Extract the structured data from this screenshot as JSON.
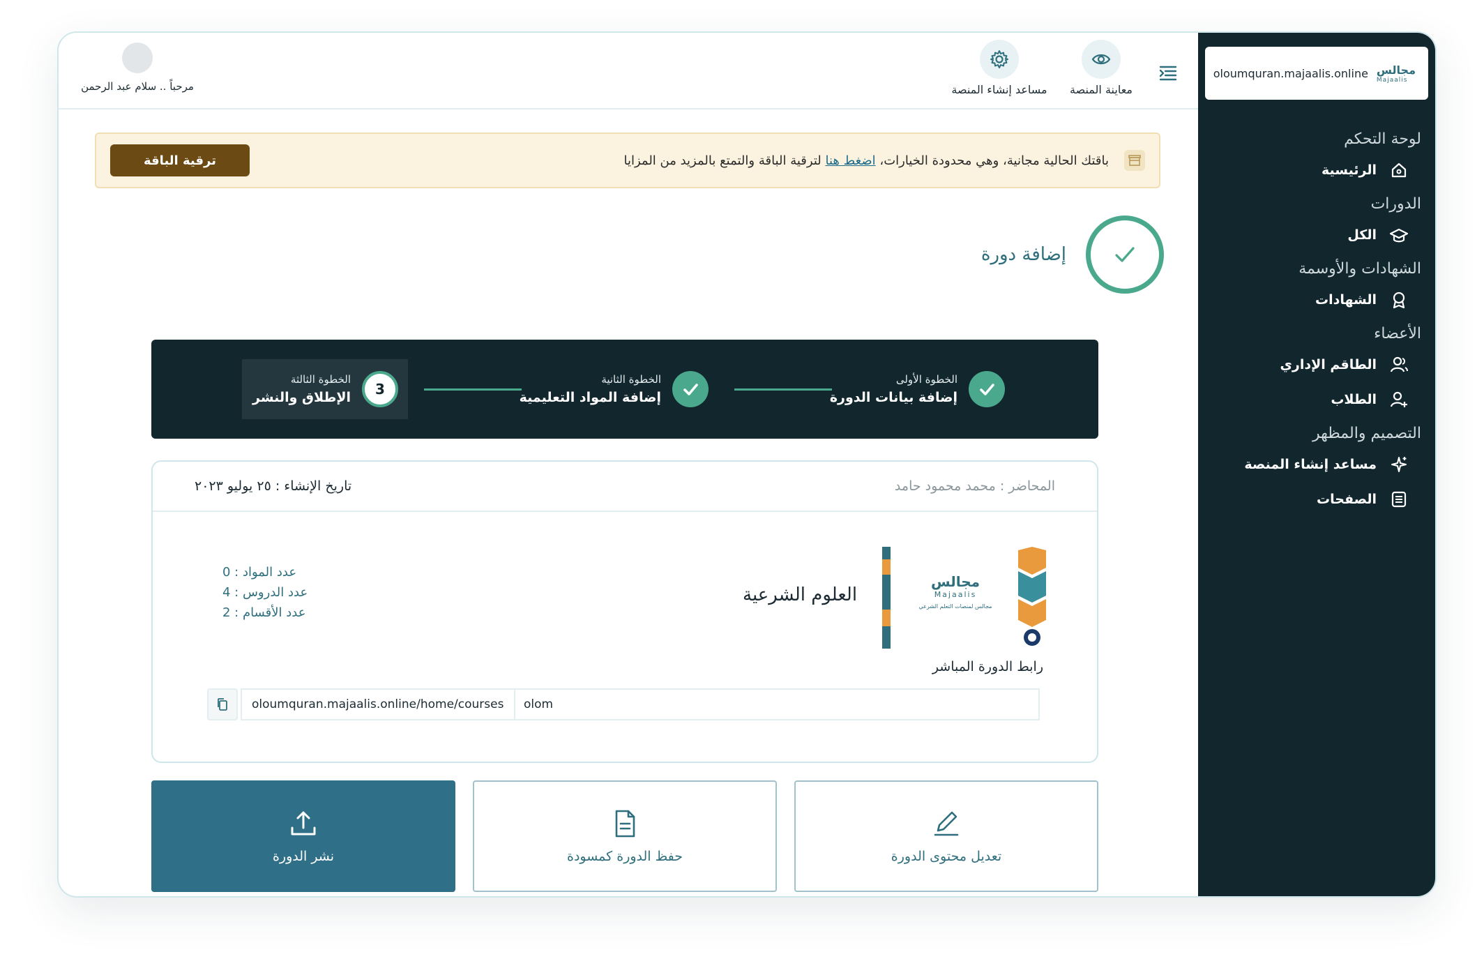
{
  "sidebar": {
    "domain": "oloumquran.majaalis.online",
    "logo_ar": "مجالس",
    "logo_en": "Majaalis",
    "sections": {
      "dashboard": "لوحة التحكم",
      "courses": "الدورات",
      "certificates": "الشهادات والأوسمة",
      "members": "الأعضاء",
      "design": "التصميم والمظهر"
    },
    "items": {
      "home": "الرئيسية",
      "all": "الكل",
      "certs": "الشهادات",
      "staff": "الطاقم الإداري",
      "students": "الطلاب",
      "wizard": "مساعد إنشاء المنصة",
      "pages": "الصفحات"
    }
  },
  "topbar": {
    "preview_label": "معاينة المنصة",
    "wizard_label": "مساعد إنشاء المنصة",
    "greeting": "مرحباً .. سلام عبد الرحمن"
  },
  "banner": {
    "text_before": "باقتك الحالية مجانية، وهي محدودة الخيارات، ",
    "link_text": "اضغط هنا",
    "text_after": " لترقية الباقة والتمتع بالمزيد من المزايا",
    "button": "ترقية الباقة"
  },
  "success": {
    "title": "إضافة دورة"
  },
  "steps": [
    {
      "small": "الخطوة الأولى",
      "big": "إضافة بيانات الدورة",
      "state": "done"
    },
    {
      "small": "الخطوة الثانية",
      "big": "إضافة المواد التعليمية",
      "state": "done"
    },
    {
      "small": "الخطوة الثالثة",
      "big": "الإطلاق والنشر",
      "state": "current",
      "num": "3"
    }
  ],
  "course": {
    "lecturer": "المحاضر : محمد محمود حامد",
    "created": "تاريخ الإنشاء : ٢٥ يوليو ٢٠٢٣",
    "name": "العلوم الشرعية",
    "logo_ar": "مجالس",
    "logo_en": "Majaalis",
    "logo_sub": "مجالس لمنصات التعلم الشرعي",
    "counts": {
      "materials": "عدد المواد : 0",
      "lessons": "عدد الدروس : 4",
      "sections": "عدد الأقسام : 2"
    },
    "live_link_label": "رابط الدورة المباشر",
    "url_prefix": "oloumquran.majaalis.online/home/courses",
    "slug": "olom"
  },
  "actions": {
    "publish": "نشر الدورة",
    "draft": "حفظ الدورة كمسودة",
    "edit": "تعديل محتوى الدورة"
  },
  "colors": {
    "sidebar_bg": "#12262e",
    "accent_green": "#4aa98c",
    "primary_teal": "#2f6f87",
    "upgrade_brown": "#6b4a14"
  }
}
